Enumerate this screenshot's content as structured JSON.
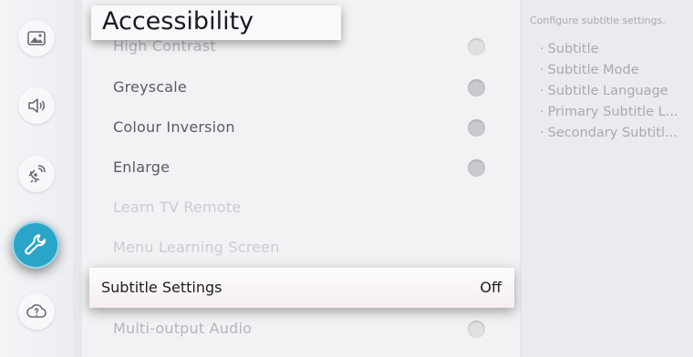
{
  "rail": {
    "items": [
      {
        "name": "picture-icon"
      },
      {
        "name": "sound-icon"
      },
      {
        "name": "broadcasting-icon"
      },
      {
        "name": "general-icon",
        "active": true
      },
      {
        "name": "support-icon"
      }
    ]
  },
  "header": {
    "title": "Accessibility"
  },
  "menu": {
    "items": [
      {
        "label": "High Contrast",
        "state": "partially-hidden"
      },
      {
        "label": "Greyscale",
        "toggle": "off"
      },
      {
        "label": "Colour Inversion",
        "toggle": "off"
      },
      {
        "label": "Enlarge",
        "toggle": "off"
      },
      {
        "label": "Learn TV Remote",
        "state": "disabled"
      },
      {
        "label": "Menu Learning Screen",
        "state": "disabled"
      },
      {
        "label": "Subtitle Settings",
        "value": "Off",
        "state": "focused"
      },
      {
        "label": "Multi-output Audio",
        "state": "partially-hidden"
      }
    ]
  },
  "info": {
    "heading": "Configure subtitle settings.",
    "bullet": "·",
    "items": [
      "Subtitle",
      "Subtitle Mode",
      "Subtitle Language",
      "Primary Subtitle L...",
      "Secondary Subtitl..."
    ]
  },
  "colors": {
    "accent": "#2aa5c7",
    "focus_bg": "#fdfcfd"
  }
}
